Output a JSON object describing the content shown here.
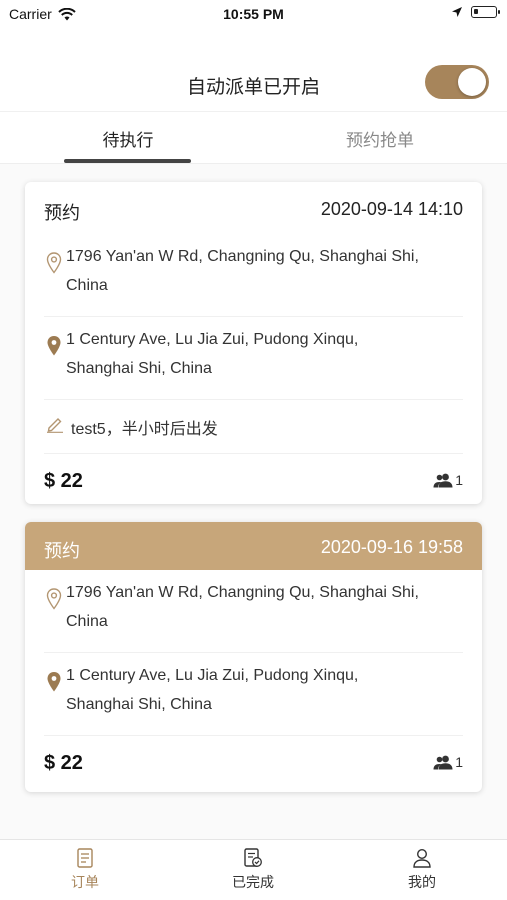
{
  "status_bar": {
    "carrier": "Carrier",
    "time": "10:55 PM"
  },
  "header": {
    "title": "自动派单已开启",
    "toggle_on": true,
    "accent": "#a7855b"
  },
  "tabs": [
    {
      "label": "待执行",
      "active": true
    },
    {
      "label": "预约抢单",
      "active": false
    }
  ],
  "orders": [
    {
      "label": "预约",
      "datetime": "2020-09-14 14:10",
      "from_line1": "1796 Yan'an W Rd, Changning Qu, Shanghai Shi,",
      "from_line2": "China",
      "to_line1": "1 Century Ave, Lu Jia Zui, Pudong Xinqu,",
      "to_line2": "Shanghai Shi, China",
      "note": "test5，半小时后出发",
      "price": "$ 22",
      "passengers": "1",
      "highlighted": false
    },
    {
      "label": "预约",
      "datetime": "2020-09-16 19:58",
      "from_line1": "1796 Yan'an W Rd, Changning Qu, Shanghai Shi,",
      "from_line2": "China",
      "to_line1": "1 Century Ave, Lu Jia Zui, Pudong Xinqu,",
      "to_line2": "Shanghai Shi, China",
      "price": "$ 22",
      "passengers": "1",
      "highlighted": true,
      "header_color": "#c7a67a"
    }
  ],
  "bottom_nav": [
    {
      "label": "订单",
      "icon": "order-list-icon",
      "active": true
    },
    {
      "label": "已完成",
      "icon": "completed-icon",
      "active": false
    },
    {
      "label": "我的",
      "icon": "profile-icon",
      "active": false
    }
  ]
}
